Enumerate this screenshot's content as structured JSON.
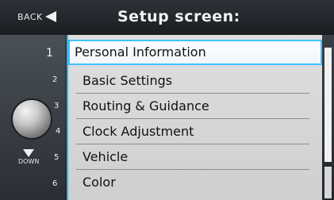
{
  "header": {
    "back_label": "BACK",
    "title": "Setup screen:"
  },
  "controls": {
    "down_label": "DOWN"
  },
  "menu": {
    "items": [
      {
        "number": "1",
        "label": "Personal Information",
        "selected": true
      },
      {
        "number": "2",
        "label": "Basic Settings",
        "selected": false
      },
      {
        "number": "3",
        "label": "Routing & Guidance",
        "selected": false
      },
      {
        "number": "4",
        "label": "Clock Adjustment",
        "selected": false
      },
      {
        "number": "5",
        "label": "Vehicle",
        "selected": false
      },
      {
        "number": "6",
        "label": "Color",
        "selected": false
      }
    ]
  },
  "colors": {
    "accent": "#2fb2e8",
    "menu_bg": "#d8d8d8"
  }
}
